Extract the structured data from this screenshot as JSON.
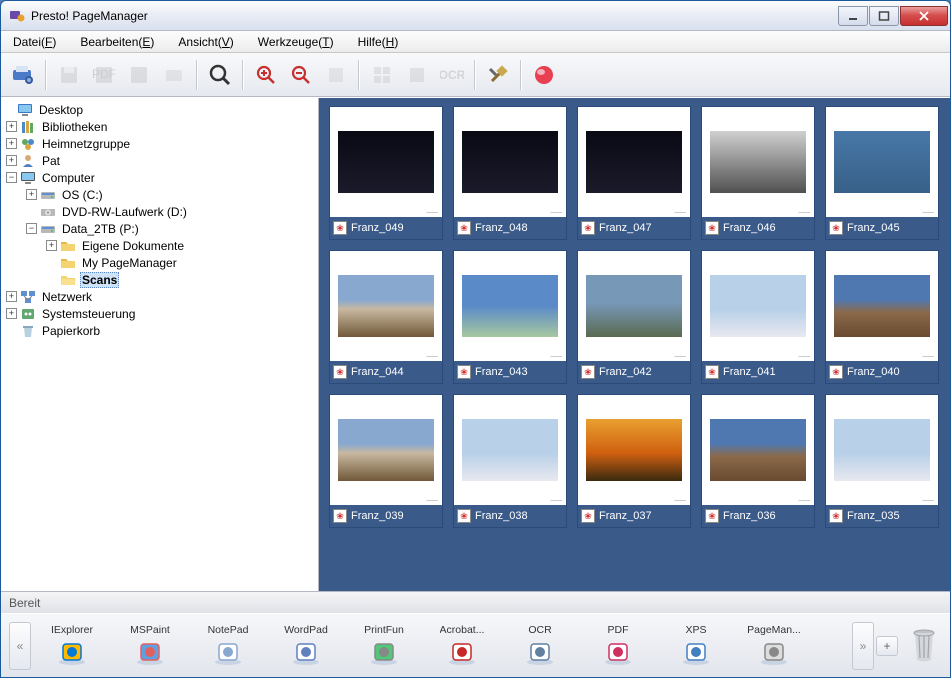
{
  "window": {
    "title": "Presto! PageManager"
  },
  "menu": {
    "file": "Datei",
    "file_u": "F",
    "edit": "Bearbeiten",
    "edit_u": "E",
    "view": "Ansicht",
    "view_u": "V",
    "tools": "Werkzeuge",
    "tools_u": "T",
    "help": "Hilfe",
    "help_u": "H"
  },
  "toolbar": {
    "scan": "scan-icon",
    "save": "save-icon",
    "pdf": "pdf-icon",
    "save2": "save2-icon",
    "send": "send-icon",
    "magnify": "magnify-icon",
    "zoomin": "zoom-in-icon",
    "zoomout": "zoom-out-icon",
    "rotate": "rotate-icon",
    "grid1": "grid-icon",
    "grid2": "grid2-icon",
    "ocr": "ocr-icon",
    "settings": "settings-icon",
    "record": "record-icon"
  },
  "tree": {
    "desktop": "Desktop",
    "bibliotheken": "Bibliotheken",
    "heimnetzgruppe": "Heimnetzgruppe",
    "pat": "Pat",
    "computer": "Computer",
    "os_c": "OS (C:)",
    "dvd_rw": "DVD-RW-Laufwerk (D:)",
    "data_2tb": "Data_2TB (P:)",
    "eigene_dok": "Eigene Dokumente",
    "my_pm": "My PageManager",
    "scans": "Scans",
    "netzwerk": "Netzwerk",
    "systemsteuerung": "Systemsteuerung",
    "papierkorb": "Papierkorb"
  },
  "thumbs": [
    {
      "name": "Franz_049",
      "style": "dark"
    },
    {
      "name": "Franz_048",
      "style": "dark"
    },
    {
      "name": "Franz_047",
      "style": "dark"
    },
    {
      "name": "Franz_046",
      "style": "bw"
    },
    {
      "name": "Franz_045",
      "style": "lake"
    },
    {
      "name": "Franz_044",
      "style": "alp"
    },
    {
      "name": "Franz_043",
      "style": "sky"
    },
    {
      "name": "Franz_042",
      "style": "rocks"
    },
    {
      "name": "Franz_041",
      "style": "snow"
    },
    {
      "name": "Franz_040",
      "style": "mtn"
    },
    {
      "name": "Franz_039",
      "style": "alp"
    },
    {
      "name": "Franz_038",
      "style": "snow"
    },
    {
      "name": "Franz_037",
      "style": "sunset"
    },
    {
      "name": "Franz_036",
      "style": "mtn"
    },
    {
      "name": "Franz_035",
      "style": "snow"
    }
  ],
  "status": {
    "text": "Bereit"
  },
  "launch": {
    "items": [
      {
        "label": "IExplorer",
        "c1": "#0078d7",
        "c2": "#ffb900"
      },
      {
        "label": "MSPaint",
        "c1": "#e06060",
        "c2": "#60a0e0"
      },
      {
        "label": "NotePad",
        "c1": "#88a8d0",
        "c2": "#fff"
      },
      {
        "label": "WordPad",
        "c1": "#6080c0",
        "c2": "#fff"
      },
      {
        "label": "PrintFun",
        "c1": "#888",
        "c2": "#50c878"
      },
      {
        "label": "Acrobat...",
        "c1": "#c62828",
        "c2": "#fff"
      },
      {
        "label": "OCR",
        "c1": "#6080a0",
        "c2": "#fff"
      },
      {
        "label": "PDF",
        "c1": "#d03060",
        "c2": "#fff"
      },
      {
        "label": "XPS",
        "c1": "#4080c0",
        "c2": "#fff"
      },
      {
        "label": "PageMan...",
        "c1": "#888",
        "c2": "#ddd"
      }
    ]
  }
}
